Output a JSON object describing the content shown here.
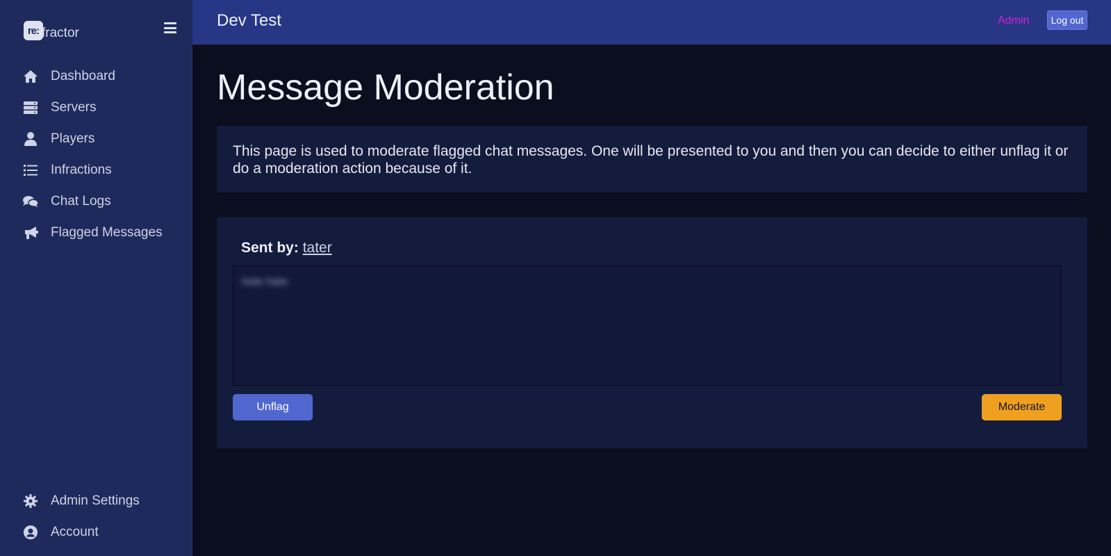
{
  "brand": {
    "logo_text": "re:",
    "name": "fractor"
  },
  "sidebar": {
    "items": [
      {
        "label": "Dashboard",
        "icon": "home-icon"
      },
      {
        "label": "Servers",
        "icon": "server-icon"
      },
      {
        "label": "Players",
        "icon": "user-icon"
      },
      {
        "label": "Infractions",
        "icon": "list-icon"
      },
      {
        "label": "Chat Logs",
        "icon": "comments-icon"
      },
      {
        "label": "Flagged Messages",
        "icon": "bullhorn-icon"
      }
    ],
    "bottom_items": [
      {
        "label": "Admin Settings",
        "icon": "gear-icon"
      },
      {
        "label": "Account",
        "icon": "user-circle-icon"
      }
    ]
  },
  "header": {
    "title": "Dev Test",
    "admin_label": "Admin",
    "logout_label": "Log out"
  },
  "main": {
    "title": "Message Moderation",
    "description": "This page is used to moderate flagged chat messages. One will be presented to you and then you can decide to either unflag it or do a moderation action because of it.",
    "sent_by_label": "Sent by:",
    "sender": "tater",
    "message": "hate hate",
    "unflag_label": "Unflag",
    "moderate_label": "Moderate"
  },
  "colors": {
    "sidebar_bg": "#1f2a5c",
    "topbar_bg": "#273685",
    "page_bg": "#0b0e1e",
    "card_bg": "#141c3d",
    "admin_link": "#d61fd6",
    "primary_button": "#5067cf",
    "moderate_button": "#f0a020"
  }
}
